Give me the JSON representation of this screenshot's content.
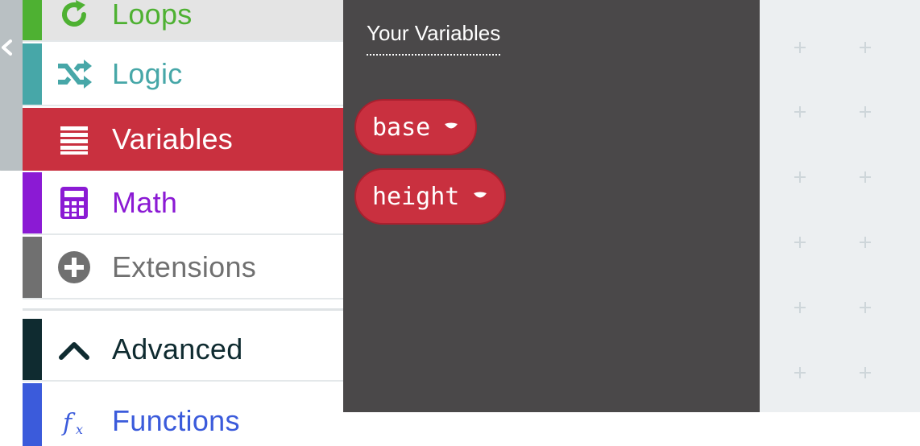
{
  "toolbox": {
    "categories": [
      {
        "id": "loops",
        "label": "Loops",
        "color": "#4eb132",
        "icon": "loop-icon"
      },
      {
        "id": "logic",
        "label": "Logic",
        "color": "#47a7a8",
        "icon": "shuffle-icon"
      },
      {
        "id": "variables",
        "label": "Variables",
        "color": "#c9303f",
        "icon": "list-icon",
        "selected": true
      },
      {
        "id": "math",
        "label": "Math",
        "color": "#8b1ad4",
        "icon": "calculator-icon"
      },
      {
        "id": "extensions",
        "label": "Extensions",
        "color": "#707070",
        "icon": "plus-circle-icon"
      },
      {
        "id": "advanced",
        "label": "Advanced",
        "color": "#0f2b30",
        "icon": "chevron-up-icon"
      },
      {
        "id": "functions",
        "label": "Functions",
        "color": "#3b5bdb",
        "icon": "function-icon"
      }
    ]
  },
  "flyout": {
    "title": "Your Variables",
    "variables": [
      {
        "name": "base"
      },
      {
        "name": "height"
      }
    ]
  }
}
